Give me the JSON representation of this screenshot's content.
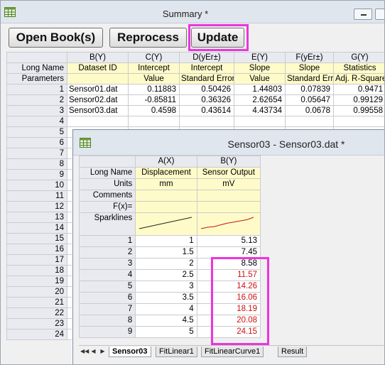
{
  "summary_window": {
    "title": "Summary *",
    "buttons": {
      "open_books": "Open Book(s)",
      "reprocess": "Reprocess",
      "update": "Update"
    },
    "columns": [
      {
        "header": "B(Y)",
        "long_name": "Dataset ID",
        "parameters": ""
      },
      {
        "header": "C(Y)",
        "long_name": "Intercept",
        "parameters": "Value"
      },
      {
        "header": "D(yEr±)",
        "long_name": "Intercept",
        "parameters": "Standard Error"
      },
      {
        "header": "E(Y)",
        "long_name": "Slope",
        "parameters": "Value"
      },
      {
        "header": "F(yEr±)",
        "long_name": "Slope",
        "parameters": "Standard Error"
      },
      {
        "header": "G(Y)",
        "long_name": "Statistics",
        "parameters": "Adj. R-Square"
      }
    ],
    "row_labels": {
      "long_name": "Long Name",
      "parameters": "Parameters"
    },
    "rows": [
      [
        "Sensor01.dat",
        "0.11883",
        "0.50426",
        "1.44803",
        "0.07839",
        "0.9471"
      ],
      [
        "Sensor02.dat",
        "-0.85811",
        "0.36326",
        "2.62654",
        "0.05647",
        "0.99129"
      ],
      [
        "Sensor03.dat",
        "0.4598",
        "0.43614",
        "4.43734",
        "0.0678",
        "0.99558"
      ]
    ],
    "row_numbers": [
      "1",
      "2",
      "3",
      "4",
      "5",
      "6",
      "7",
      "8",
      "9",
      "10",
      "11",
      "12",
      "13",
      "14",
      "15",
      "16",
      "17",
      "18",
      "19",
      "20",
      "21",
      "22",
      "23",
      "24"
    ]
  },
  "sensor_window": {
    "title": "Sensor03 - Sensor03.dat *",
    "columns": [
      {
        "header": "A(X)",
        "long_name": "Displacement",
        "units": "mm"
      },
      {
        "header": "B(Y)",
        "long_name": "Sensor Output",
        "units": "mV"
      }
    ],
    "meta_labels": {
      "long_name": "Long Name",
      "units": "Units",
      "comments": "Comments",
      "fx": "F(x)=",
      "sparklines": "Sparklines"
    },
    "data": [
      [
        "1",
        "5.13"
      ],
      [
        "1.5",
        "7.45"
      ],
      [
        "2",
        "8.58"
      ],
      [
        "2.5",
        "11.57"
      ],
      [
        "3",
        "14.26"
      ],
      [
        "3.5",
        "16.06"
      ],
      [
        "4",
        "18.19"
      ],
      [
        "4.5",
        "20.08"
      ],
      [
        "5",
        "24.15"
      ]
    ],
    "row_numbers": [
      "1",
      "2",
      "3",
      "4",
      "5",
      "6",
      "7",
      "8",
      "9"
    ],
    "red_rows_from": 3,
    "tabs": [
      "Sensor03",
      "FitLinear1",
      "FitLinearCurve1",
      "Result"
    ],
    "active_tab": "Sensor03"
  },
  "colors": {
    "highlight": "#ee33dd",
    "red_value": "#d01010",
    "meta_background": "#fffbc8"
  },
  "icons": {
    "workbook": "workbook-grid-icon",
    "minimize": "minimize-icon"
  }
}
